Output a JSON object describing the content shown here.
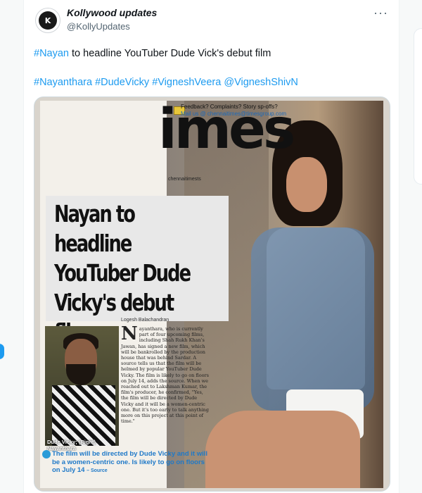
{
  "tweet": {
    "author_name": "Kollywood updates",
    "author_handle": "@KollyUpdates",
    "avatar_text": "K",
    "more_label": "···",
    "text_hashtag": "#Nayan",
    "text_body": " to headline YouTuber Dude Vick's debut film",
    "tags": [
      "#Nayanthara",
      "#DudeVicky",
      "#VigneshVeera",
      "@VigneshShivN"
    ]
  },
  "newspaper": {
    "masthead": "imes",
    "feedback_line1": "Feedback? Complaints? Story sp-offs?",
    "feedback_line2": "Mail us @ chennaitimes@timesgroup.com",
    "byline_small": "chennaitimests",
    "headline": "Nayan to headline YouTuber Dude Vicky's debut film",
    "author": "Logesh Balachandran",
    "dropcap": "N",
    "body": "ayanthara, who is currently part of four upcoming films, including Shah Rukh Khan's Jawan, has signed a new film, which will be bankrolled by the production house that was behind Sardar. A source tells us that the film will be helmed by popular YouTuber Dude Vicky. The film is likely to go on floors on July 14, adds the source. When we reached out to Lakshman Kumar, the film's producer, he confirmed, \"Yes, the film will be directed by Dude Vicky and it will be a women-centric one. But it's too early to talk anything more on this project at this point of time.\"",
    "caption_line1": "Dude Vicky; (Right)",
    "caption_line2": "Nayanthara",
    "quote": "The film will be directed by Dude Vicky and it will be a women-centric one. Is likely to go on floors on July 14",
    "quote_source": "– Source"
  },
  "colors": {
    "hashtag": "#1d9bf0",
    "quote_blue": "#1f79c8"
  }
}
